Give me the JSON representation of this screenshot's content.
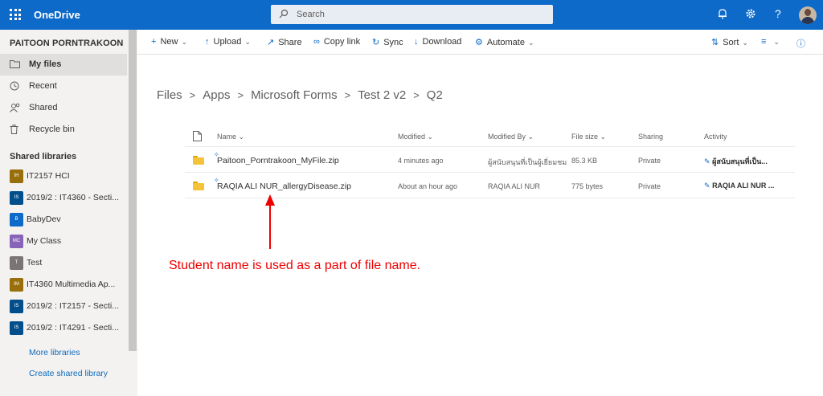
{
  "topbar": {
    "app_name": "OneDrive",
    "search_placeholder": "Search",
    "icons": [
      "waffle-icon",
      "bell-icon",
      "gear-icon",
      "help-icon",
      "avatar"
    ]
  },
  "sidebar": {
    "user": "PAITOON PORNTRAKOON",
    "nav": [
      {
        "label": "My files",
        "icon": "folder-icon",
        "active": true
      },
      {
        "label": "Recent",
        "icon": "clock-icon"
      },
      {
        "label": "Shared",
        "icon": "people-icon"
      },
      {
        "label": "Recycle bin",
        "icon": "trash-icon"
      }
    ],
    "shared_title": "Shared libraries",
    "libraries": [
      {
        "badge": "IH",
        "label": "IT2157 HCI",
        "color": "#986f0b"
      },
      {
        "badge": "IS",
        "label": "2019/2 : IT4360 - Secti...",
        "color": "#004e8c"
      },
      {
        "badge": "B",
        "label": "BabyDev",
        "color": "#0e6ac8"
      },
      {
        "badge": "MC",
        "label": "My Class",
        "color": "#8764b8"
      },
      {
        "badge": "T",
        "label": "Test",
        "color": "#7a7574"
      },
      {
        "badge": "IM",
        "label": "IT4360 Multimedia Ap...",
        "color": "#986f0b"
      },
      {
        "badge": "IS",
        "label": "2019/2 : IT2157 - Secti...",
        "color": "#004e8c"
      },
      {
        "badge": "IS",
        "label": "2019/2 : IT4291 - Secti...",
        "color": "#004e8c"
      }
    ],
    "more_libraries": "More libraries",
    "create_library": "Create shared library"
  },
  "commands": {
    "new": "New",
    "upload": "Upload",
    "share": "Share",
    "copy_link": "Copy link",
    "sync": "Sync",
    "download": "Download",
    "automate": "Automate",
    "sort": "Sort"
  },
  "breadcrumb": [
    "Files",
    "Apps",
    "Microsoft Forms",
    "Test 2 v2",
    "Q2"
  ],
  "columns": {
    "name": "Name",
    "modified": "Modified",
    "modified_by": "Modified By",
    "file_size": "File size",
    "sharing": "Sharing",
    "activity": "Activity"
  },
  "files": [
    {
      "name": "Paitoon_Porntrakoon_MyFile.zip",
      "modified": "4 minutes ago",
      "modified_by": "ผู้สนับสนุนที่เป็นผู้เยี่ยมชม",
      "size": "85.3 KB",
      "sharing": "Private",
      "activity": "ผู้สนับสนุนที่เป็น..."
    },
    {
      "name": "RAQIA ALI NUR_allergyDisease.zip",
      "modified": "About an hour ago",
      "modified_by": "RAQIA ALI NUR",
      "size": "775 bytes",
      "sharing": "Private",
      "activity": "RAQIA ALI NUR ..."
    }
  ],
  "annotation": "Student name is used as a part of file name.",
  "colors": {
    "brand_blue": "#0e6ac8",
    "annotation_red": "#ee0000",
    "folder_yellow": "#f5c338"
  }
}
